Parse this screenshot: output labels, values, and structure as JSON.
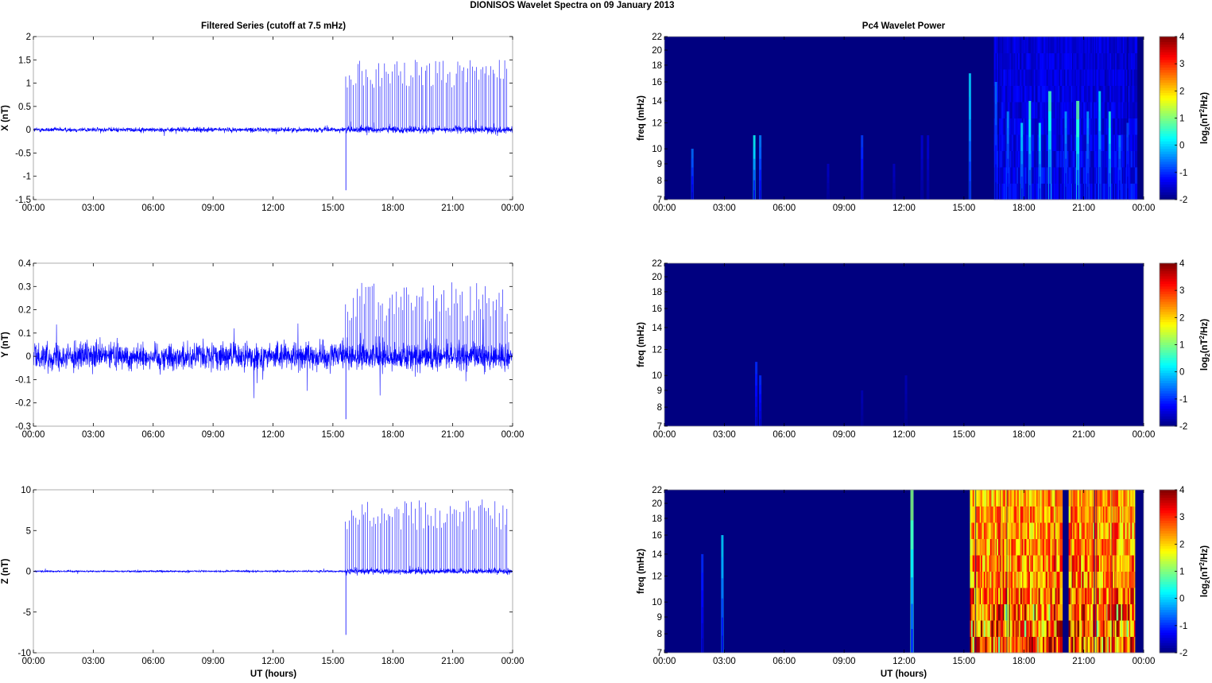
{
  "chart_data": {
    "title": "DIONISOS Wavelet Spectra on 09 January   2013",
    "left_title": "Filtered Series (cutoff at 7.5 mHz)",
    "right_title": "Pc4 Wavelet Power",
    "xlabel": "UT (hours)",
    "xticks": [
      "00:00",
      "03:00",
      "06:00",
      "09:00",
      "12:00",
      "15:00",
      "18:00",
      "21:00",
      "00:00"
    ],
    "xlim_hours": [
      0,
      24
    ],
    "series_color": "#0000ff",
    "time_series": [
      {
        "type": "line",
        "name": "X",
        "ylabel": "X (nT)",
        "ylim": [
          -1.5,
          2
        ],
        "yticks": [
          "2",
          "1.5",
          "1",
          "0.5",
          "0",
          "-0.5",
          "-1",
          "-1.5"
        ],
        "ytick_values": [
          2,
          1.5,
          1,
          0.5,
          0,
          -0.5,
          -1,
          -1.5
        ],
        "noise_early": 0.035,
        "noise_late": 0.05,
        "spike_start_hour": 15.6,
        "spike_max": 1.5,
        "spike_min": 0.9,
        "spike_count": 80,
        "neg_spike_hour": 15.65,
        "neg_spike_value": -1.3
      },
      {
        "type": "line",
        "name": "Y",
        "ylabel": "Y (nT)",
        "ylim": [
          -0.3,
          0.4
        ],
        "yticks": [
          "0.4",
          "0.3",
          "0.2",
          "0.1",
          "0",
          "-0.1",
          "-0.2",
          "-0.3"
        ],
        "ytick_values": [
          0.4,
          0.3,
          0.2,
          0.1,
          0,
          -0.1,
          -0.2,
          -0.3
        ],
        "noise_early": 0.04,
        "noise_late": 0.04,
        "spike_start_hour": 15.6,
        "spike_max": 0.32,
        "spike_min": 0.15,
        "spike_count": 80,
        "neg_spike_hour": 15.65,
        "neg_spike_value": -0.27
      },
      {
        "type": "line",
        "name": "Z",
        "ylabel": "Z (nT)",
        "ylim": [
          -10,
          10
        ],
        "yticks": [
          "10",
          "5",
          "0",
          "-5",
          "-10"
        ],
        "ytick_values": [
          10,
          5,
          0,
          -5,
          -10
        ],
        "noise_early": 0.08,
        "noise_late": 0.25,
        "spike_start_hour": 15.6,
        "spike_max": 8.8,
        "spike_min": 5,
        "spike_count": 80,
        "neg_spike_hour": 15.65,
        "neg_spike_value": -7.8
      }
    ],
    "spectra": [
      {
        "type": "heatmap",
        "name": "X power",
        "ylabel": "freq (mHz)",
        "bursts": [
          [
            1.4,
            -0.6,
            10
          ],
          [
            4.5,
            0.3,
            11
          ],
          [
            4.8,
            -0.5,
            11
          ],
          [
            8.2,
            -1.6,
            9
          ],
          [
            9.9,
            -0.9,
            11
          ],
          [
            11.5,
            -1.6,
            9
          ],
          [
            12.9,
            -1.5,
            11
          ],
          [
            13.2,
            -1.5,
            11
          ],
          [
            15.3,
            0,
            17
          ],
          [
            16.6,
            -0.6,
            16
          ],
          [
            17.2,
            -0.4,
            13
          ],
          [
            17.9,
            0.1,
            12
          ],
          [
            18.3,
            0.5,
            14
          ],
          [
            18.8,
            0.2,
            12
          ],
          [
            19.3,
            0.6,
            15
          ],
          [
            20.1,
            -0.3,
            13
          ],
          [
            20.7,
            0.8,
            14
          ],
          [
            21.2,
            -0.3,
            13
          ],
          [
            21.8,
            0.1,
            15
          ],
          [
            22.3,
            0.4,
            13
          ],
          [
            22.8,
            -0.5,
            11
          ],
          [
            23.2,
            -0.8,
            12
          ]
        ],
        "dense": {
          "start": 16.5,
          "end": 23.6,
          "gap": [
            0,
            0
          ],
          "base": -1.7,
          "peak": -1.0
        }
      },
      {
        "type": "heatmap",
        "name": "Y power",
        "ylabel": "freq (mHz)",
        "bursts": [
          [
            4.6,
            -1.0,
            11
          ],
          [
            4.8,
            -1.0,
            10
          ],
          [
            9.9,
            -1.7,
            9
          ],
          [
            12.1,
            -1.7,
            10
          ]
        ],
        "dense": null
      },
      {
        "type": "heatmap",
        "name": "Z power",
        "ylabel": "freq (mHz)",
        "bursts": [
          [
            1.9,
            -1.0,
            14
          ],
          [
            2.9,
            0.0,
            16
          ],
          [
            12.4,
            1.0,
            22
          ]
        ],
        "dense": {
          "start": 15.3,
          "end": 23.6,
          "gap": [
            19.8,
            20.2
          ],
          "base": 1.5,
          "peak": 4
        }
      }
    ],
    "freq_ticks": [
      7,
      8,
      9,
      10,
      12,
      14,
      16,
      18,
      20,
      22
    ],
    "freq_lim": [
      7,
      22
    ],
    "colorbar": {
      "label": "log2(nT^2/Hz)",
      "label_base": "log",
      "label_sub": "2",
      "label_rest": "(nT",
      "label_sup": "2",
      "label_end": "/Hz)",
      "range": [
        -2,
        4
      ],
      "ticks": [
        "4",
        "3",
        "2",
        "1",
        "0",
        "-1",
        "-2"
      ],
      "colormap": "jet"
    }
  }
}
